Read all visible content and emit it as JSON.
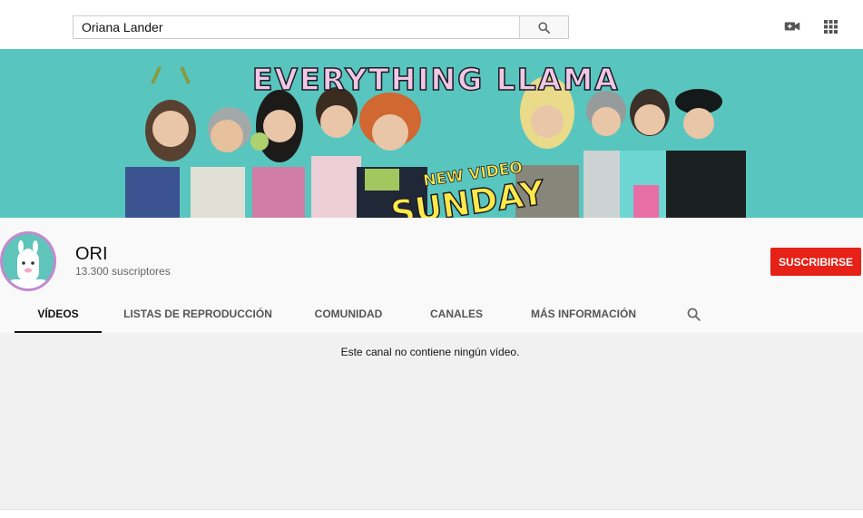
{
  "search": {
    "value": "Oriana Lander"
  },
  "topbar": {
    "icons": [
      "search-icon",
      "video-camera-icon",
      "apps-grid-icon"
    ]
  },
  "banner": {
    "title": "EVERYTHING LLAMA",
    "subtitle": "NEW VIDEO",
    "day": "SUNDAY",
    "background_color": "#58c6be"
  },
  "channel": {
    "name": "ORI",
    "subscribers": "13.300 suscriptores",
    "subscribe_label": "SUSCRIBIRSE",
    "subscribe_color": "#e62117"
  },
  "tabs": [
    {
      "label": "VÍDEOS",
      "active": true
    },
    {
      "label": "LISTAS DE REPRODUCCIÓN",
      "active": false
    },
    {
      "label": "COMUNIDAD",
      "active": false
    },
    {
      "label": "CANALES",
      "active": false
    },
    {
      "label": "MÁS INFORMACIÓN",
      "active": false
    }
  ],
  "content": {
    "empty_message": "Este canal no contiene ningún vídeo."
  }
}
